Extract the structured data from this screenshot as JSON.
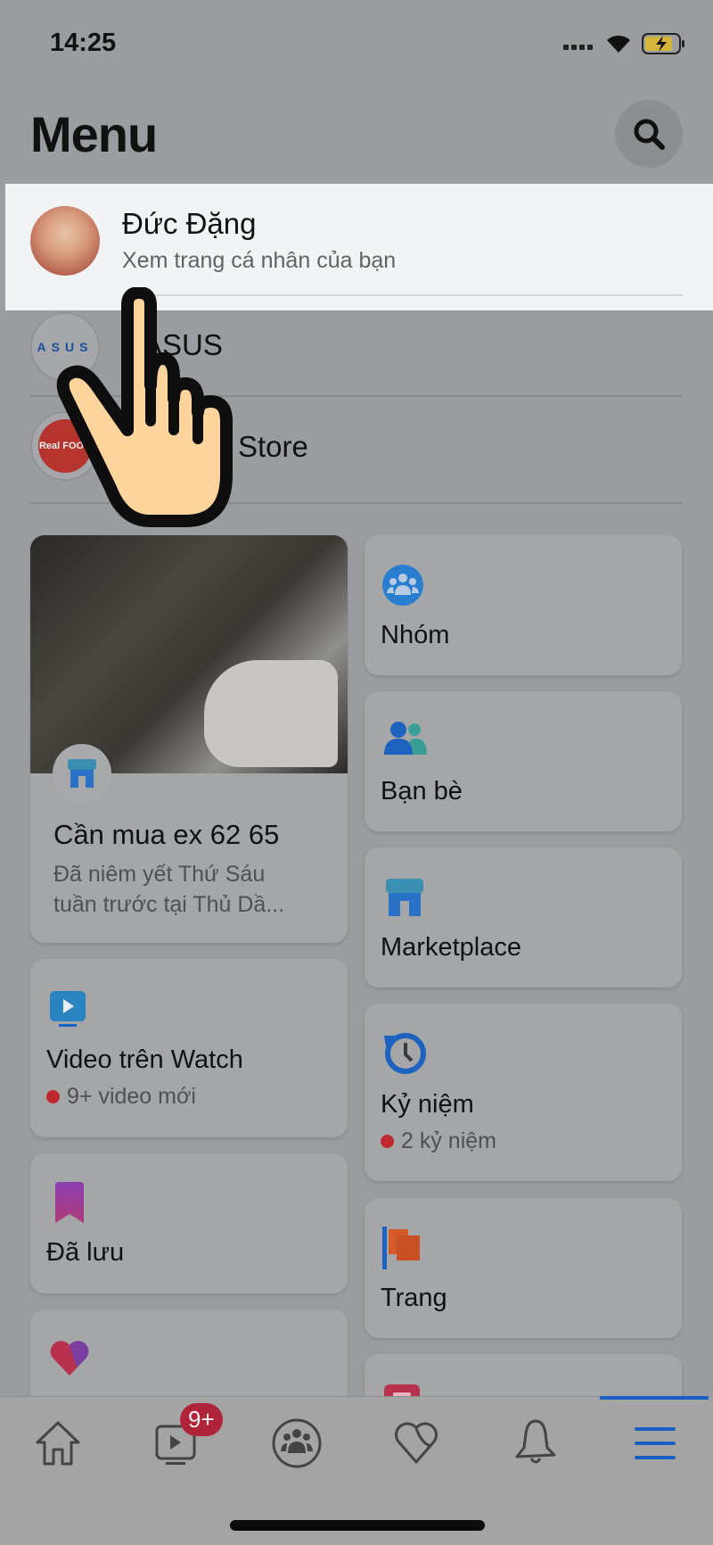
{
  "status_bar": {
    "time": "14:25"
  },
  "header": {
    "title": "Menu",
    "search_icon": "search-icon"
  },
  "profile": {
    "name": "Đức Đặng",
    "subtitle": "Xem trang cá nhân của bạn"
  },
  "pages": [
    {
      "name": "ASUS",
      "logo_text": "ASUS"
    },
    {
      "name": "Store",
      "logo_text": "Real FOOD"
    }
  ],
  "shortcuts": {
    "marketplace_listing": {
      "title": "Cần mua ex 62 65",
      "subtitle_line1": "Đã niêm yết Thứ Sáu",
      "subtitle_line2": "tuần trước tại Thủ Dầ..."
    },
    "left": [
      {
        "label": "Video trên Watch",
        "sub": "9+ video mới",
        "icon": "watch-icon"
      },
      {
        "label": "Đã lưu",
        "icon": "bookmark-icon"
      },
      {
        "label": "",
        "icon": "dating-heart-icon"
      }
    ],
    "right": [
      {
        "label": "Nhóm",
        "icon": "groups-icon"
      },
      {
        "label": "Bạn bè",
        "icon": "friends-icon"
      },
      {
        "label": "Marketplace",
        "icon": "marketplace-icon"
      },
      {
        "label": "Kỷ niệm",
        "sub": "2 kỷ niệm",
        "icon": "memories-icon"
      },
      {
        "label": "Trang",
        "icon": "pages-flag-icon"
      },
      {
        "label": "",
        "icon": "events-icon"
      }
    ]
  },
  "bottom_nav": {
    "items": [
      "home-icon",
      "watch-icon",
      "groups-icon",
      "dating-icon",
      "bell-icon",
      "menu-icon"
    ],
    "watch_badge": "9+",
    "active": "menu"
  },
  "colors": {
    "accent": "#1a5fc4",
    "badge": "#b0243a",
    "highlight": "#f2f3f5"
  }
}
